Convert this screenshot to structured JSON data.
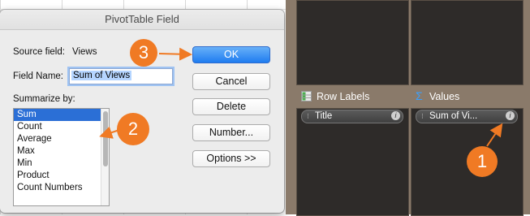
{
  "dialog": {
    "title": "PivotTable Field",
    "source_field_label": "Source field:",
    "source_field_value": "Views",
    "field_name_label": "Field Name:",
    "field_name_value": "Sum of Views",
    "summarize_label": "Summarize by:",
    "summarize_options": [
      "Sum",
      "Count",
      "Average",
      "Max",
      "Min",
      "Product",
      "Count Numbers"
    ],
    "selected_option": "Sum"
  },
  "buttons": {
    "ok": "OK",
    "cancel": "Cancel",
    "delete": "Delete",
    "number": "Number...",
    "options": "Options >>"
  },
  "pivot": {
    "row_labels_title": "Row Labels",
    "values_title": "Values",
    "row_item": "Title",
    "value_item": "Sum of Vi..."
  },
  "callouts": [
    "1",
    "2",
    "3"
  ],
  "colors": {
    "callout": "#f07a24",
    "selected": "#2b6fd6",
    "panel_bg": "#8a7a6a",
    "pane_bg": "#2e2b29"
  }
}
